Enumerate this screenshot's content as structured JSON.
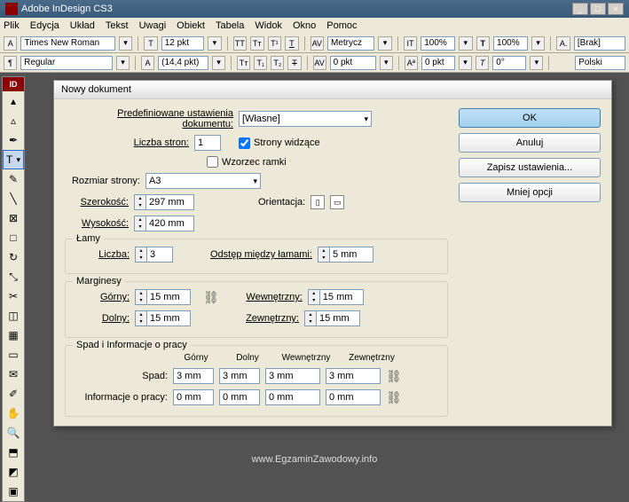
{
  "titlebar": {
    "app_name": "Adobe InDesign CS3"
  },
  "menubar": [
    "Plik",
    "Edycja",
    "Układ",
    "Tekst",
    "Uwagi",
    "Obiekt",
    "Tabela",
    "Widok",
    "Okno",
    "Pomoc"
  ],
  "toolbar1": {
    "font": "Times New Roman",
    "size": "12 pkt",
    "tt": "TT",
    "t1": "T",
    "t2": "T",
    "metrics": "Metrycz",
    "it100a": "100%",
    "it100b": "100%",
    "style": "[Brak]"
  },
  "toolbar2": {
    "weight": "Regular",
    "leading": "(14,4 pkt)",
    "kern": "0 pkt",
    "angle": "0°",
    "lang": "Polski"
  },
  "dialog": {
    "title": "Nowy dokument",
    "preset_label": "Predefiniowane ustawienia dokumentu:",
    "preset_value": "[Własne]",
    "pages_label": "Liczba stron:",
    "pages_value": "1",
    "facing_label": "Strony widzące",
    "master_label": "Wzorzec ramki",
    "page_size_label": "Rozmiar strony:",
    "page_size_value": "A3",
    "width_label": "Szerokość:",
    "width_value": "297 mm",
    "height_label": "Wysokość:",
    "height_value": "420 mm",
    "orientation_label": "Orientacja:",
    "columns_title": "Łamy",
    "columns_count_label": "Liczba:",
    "columns_count_value": "3",
    "gutter_label": "Odstęp między łamami:",
    "gutter_value": "5 mm",
    "margins_title": "Marginesy",
    "margin_top_label": "Górny:",
    "margin_top_value": "15 mm",
    "margin_bottom_label": "Dolny:",
    "margin_bottom_value": "15 mm",
    "margin_inside_label": "Wewnętrzny:",
    "margin_inside_value": "15 mm",
    "margin_outside_label": "Zewnętrzny:",
    "margin_outside_value": "15 mm",
    "bleed_title": "Spad i Informacje o pracy",
    "col_top": "Górny",
    "col_bottom": "Dolny",
    "col_inside": "Wewnętrzny",
    "col_outside": "Zewnętrzny",
    "bleed_label": "Spad:",
    "bleed_top": "3 mm",
    "bleed_bottom": "3 mm",
    "bleed_inside": "3 mm",
    "bleed_outside": "3 mm",
    "slug_label": "Informacje o pracy:",
    "slug_top": "0 mm",
    "slug_bottom": "0 mm",
    "slug_inside": "0 mm",
    "slug_outside": "0 mm",
    "btn_ok": "OK",
    "btn_cancel": "Anuluj",
    "btn_save": "Zapisz ustawienia...",
    "btn_less": "Mniej opcji"
  },
  "footer": "www.EgzaminZawodowy.info"
}
